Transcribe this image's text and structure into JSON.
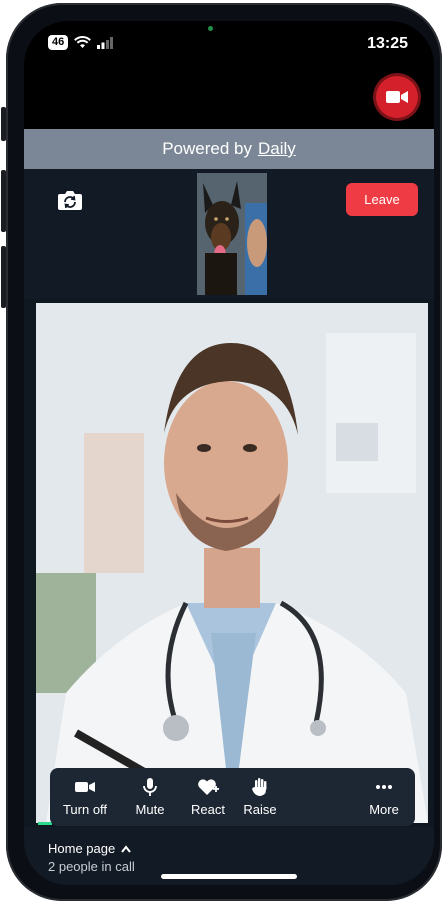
{
  "status_bar": {
    "network_badge": "46",
    "time": "13:25"
  },
  "header": {
    "record_icon": "video-camera-icon",
    "accent": "#d3202b"
  },
  "powered_by": {
    "prefix": "Powered by",
    "link": "Daily"
  },
  "call": {
    "flip_icon": "camera-flip-icon",
    "leave_label": "Leave",
    "leave_color": "#ef3b43"
  },
  "toolbar": {
    "items": [
      {
        "label": "Turn off",
        "icon": "video-camera-icon"
      },
      {
        "label": "Mute",
        "icon": "microphone-icon"
      },
      {
        "label": "React",
        "icon": "heart-plus-icon"
      },
      {
        "label": "Raise",
        "icon": "raise-hand-icon"
      },
      {
        "label": "More",
        "icon": "more-dots-icon"
      }
    ]
  },
  "footer": {
    "title": "Home page",
    "subtitle": "2 people in call"
  }
}
